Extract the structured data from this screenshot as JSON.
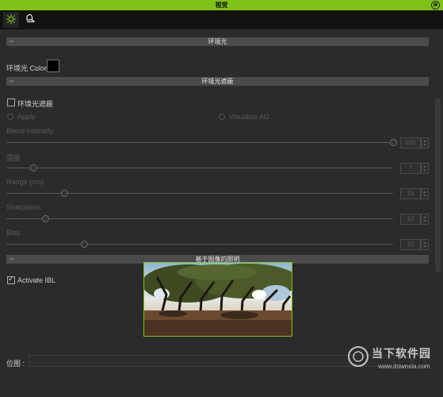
{
  "window": {
    "title": "视觉",
    "close_symbol": "⊗"
  },
  "toolbar": {
    "tabs": [
      {
        "icon": "sun-icon",
        "active": true
      },
      {
        "icon": "lamp-icon",
        "active": false
      }
    ]
  },
  "sections": {
    "ambient": {
      "title": "环境光",
      "color_label": "环境光 Color :"
    },
    "ao": {
      "title": "环境光遮蔽",
      "enable_label": "环境光遮蔽",
      "apply_label": "Apply",
      "visualize_label": "Visualize AO",
      "params": [
        {
          "label": "Blend Intensity",
          "value": "100",
          "level": 1.0
        },
        {
          "label": "强度",
          "value": "7",
          "level": 0.07
        },
        {
          "label": "Range (cm)",
          "value": "15",
          "level": 0.15
        },
        {
          "label": "Sharpness",
          "value": "10",
          "level": 0.1
        },
        {
          "label": "Bias",
          "value": "20",
          "level": 0.2
        }
      ]
    },
    "ibl": {
      "title": "基于图像的照明",
      "activate_label": "Activate IBL",
      "position_label": "位图 :"
    }
  },
  "watermark": {
    "text": "当下软件园",
    "sub": "www.downxia.com"
  },
  "colors": {
    "accent": "#7ec21a",
    "background": "#2b2b2b",
    "toolbar": "#121212",
    "section": "#4b4b4b"
  }
}
